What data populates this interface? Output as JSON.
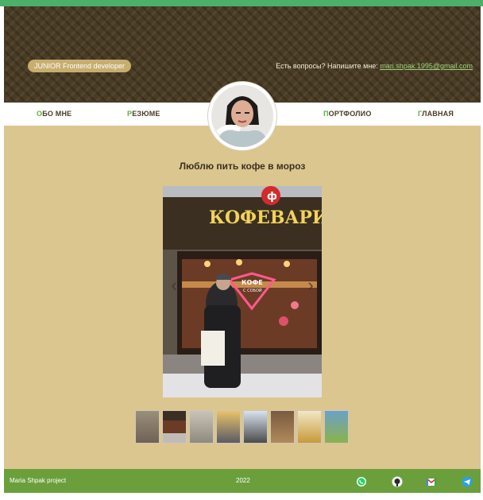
{
  "hero": {
    "badge": "JUNIOR Frontend developer",
    "contact_prefix": "Есть вопросы? Напишите мне: ",
    "contact_email": "mari.shpak.1995@gmail.com"
  },
  "nav": {
    "about": {
      "first": "О",
      "rest": "БО МНЕ"
    },
    "resume": {
      "first": "Р",
      "rest": "ЕЗЮМЕ"
    },
    "portfolio": {
      "first": "П",
      "rest": "ОРТФОЛИО"
    },
    "home": {
      "first": "Г",
      "rest": "ЛАВНАЯ"
    }
  },
  "gallery": {
    "caption": "Люблю пить кофе в мороз",
    "sign_text": "КОФЕВАРИМ",
    "logo_letter": "ф",
    "neon_text": "КОФЕ",
    "neon_sub": "С СОБОЙ",
    "prev_icon": "chevron-left-icon",
    "next_icon": "chevron-right-icon",
    "thumb_count": 8
  },
  "footer": {
    "project": "Maria Shpak project",
    "year": "2022",
    "icons": [
      "whatsapp-icon",
      "github-icon",
      "gmail-icon",
      "telegram-icon"
    ]
  },
  "colors": {
    "accent": "#5cae3c",
    "hero_bg": "#4a3c24",
    "content_bg": "#dbc68f",
    "footer_bg": "#6b9f3c",
    "badge_bg": "#c7ad6e"
  }
}
